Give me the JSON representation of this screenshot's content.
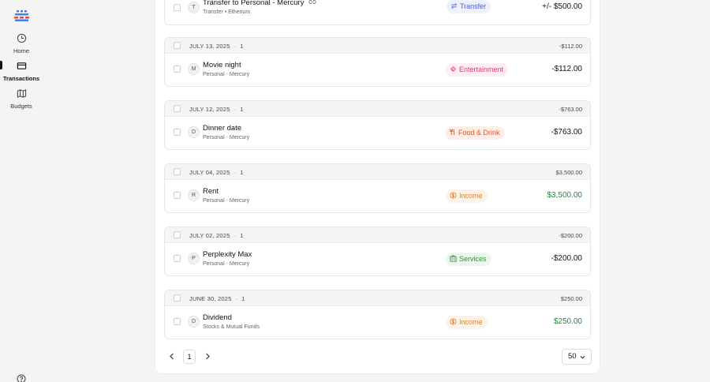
{
  "colors": {
    "accent": "#3b82f6",
    "transfer": "#4a5ec9",
    "entertainment": "#d6436e",
    "food": "#d9582b",
    "income": "#d9822b",
    "services": "#2f8f3f",
    "positive": "#1f8a3f"
  },
  "sidebar": {
    "items": [
      {
        "label": "Home",
        "icon": "clock-icon"
      },
      {
        "label": "Transactions",
        "icon": "credit-card-icon"
      },
      {
        "label": "Budgets",
        "icon": "map-icon"
      }
    ],
    "bottom_icon": "help-icon"
  },
  "top_transaction": {
    "avatar": "T",
    "name": "Transfer to Personal - Mercury",
    "sub": "Transfer • Etherium",
    "category": "Transfer",
    "amount": "+/- $500.00"
  },
  "groups": [
    {
      "date": "JULY 13, 2025",
      "count": "1",
      "total": "-$112.00",
      "tx": {
        "avatar": "M",
        "name": "Movie night",
        "sub": "Personal - Mercury",
        "category": "Entertainment",
        "amount": "-$112.00"
      }
    },
    {
      "date": "JULY 12, 2025",
      "count": "1",
      "total": "-$763.00",
      "tx": {
        "avatar": "D",
        "name": "Dinner date",
        "sub": "Personal - Mercury",
        "category": "Food & Drink",
        "amount": "-$763.00"
      }
    },
    {
      "date": "JULY 04, 2025",
      "count": "1",
      "total": "$3,500.00",
      "tx": {
        "avatar": "R",
        "name": "Rent",
        "sub": "Personal - Mercury",
        "category": "Income",
        "amount": "$3,500.00"
      }
    },
    {
      "date": "JULY 02, 2025",
      "count": "1",
      "total": "-$200.00",
      "tx": {
        "avatar": "P",
        "name": "Perplexity Max",
        "sub": "Personal - Mercury",
        "category": "Services",
        "amount": "-$200.00"
      }
    },
    {
      "date": "JUNE 30, 2025",
      "count": "1",
      "total": "$250.00",
      "tx": {
        "avatar": "D",
        "name": "Dividend",
        "sub": "Stocks & Mutual Funds",
        "category": "Income",
        "amount": "$250.00"
      }
    }
  ],
  "pagination": {
    "current_page": "1",
    "page_size": "50"
  }
}
